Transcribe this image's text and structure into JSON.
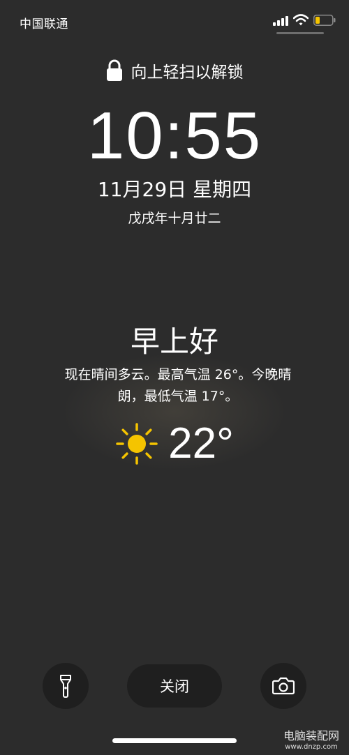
{
  "status_bar": {
    "carrier": "中国联通",
    "signal_icon": "cellular-signal-icon",
    "wifi_icon": "wifi-icon",
    "battery_icon": "battery-low-icon",
    "battery_color": "#f5c400"
  },
  "lock": {
    "icon": "lock-icon",
    "prompt": "向上轻扫以解锁"
  },
  "clock": {
    "time": "10:55",
    "date": "11月29日 星期四",
    "lunar_date": "戊戌年十月廿二"
  },
  "weather": {
    "greeting": "早上好",
    "forecast_line1": "现在晴间多云。最高气温 26°。今晚晴",
    "forecast_line2": "朗，最低气温 17°。",
    "icon": "sun-icon",
    "icon_color": "#f5c400",
    "temperature": "22°"
  },
  "controls": {
    "flashlight_icon": "flashlight-icon",
    "close_label": "关闭",
    "camera_icon": "camera-icon"
  },
  "watermark": {
    "main": "电脑装配网",
    "sub": "www.dnzp.com"
  }
}
